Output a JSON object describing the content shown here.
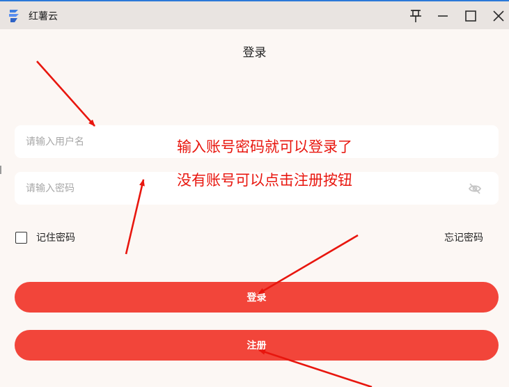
{
  "window": {
    "title": "红薯云"
  },
  "login": {
    "title": "登录",
    "username_placeholder": "请输入用户名",
    "password_placeholder": "请输入密码",
    "remember_label": "记住密码",
    "forgot_label": "忘记密码",
    "login_button": "登录",
    "register_button": "注册"
  },
  "annotations": {
    "line1": "输入账号密码就可以登录了",
    "line2": "没有账号可以点击注册按钮"
  },
  "colors": {
    "accent": "#f2453a",
    "annotation": "#e8160e",
    "background": "#fcf7f4",
    "titlebar": "#e9e4e1"
  },
  "icons": [
    "app-logo",
    "pin-icon",
    "minimize-icon",
    "maximize-icon",
    "close-icon",
    "eye-off-icon",
    "checkbox-icon"
  ]
}
